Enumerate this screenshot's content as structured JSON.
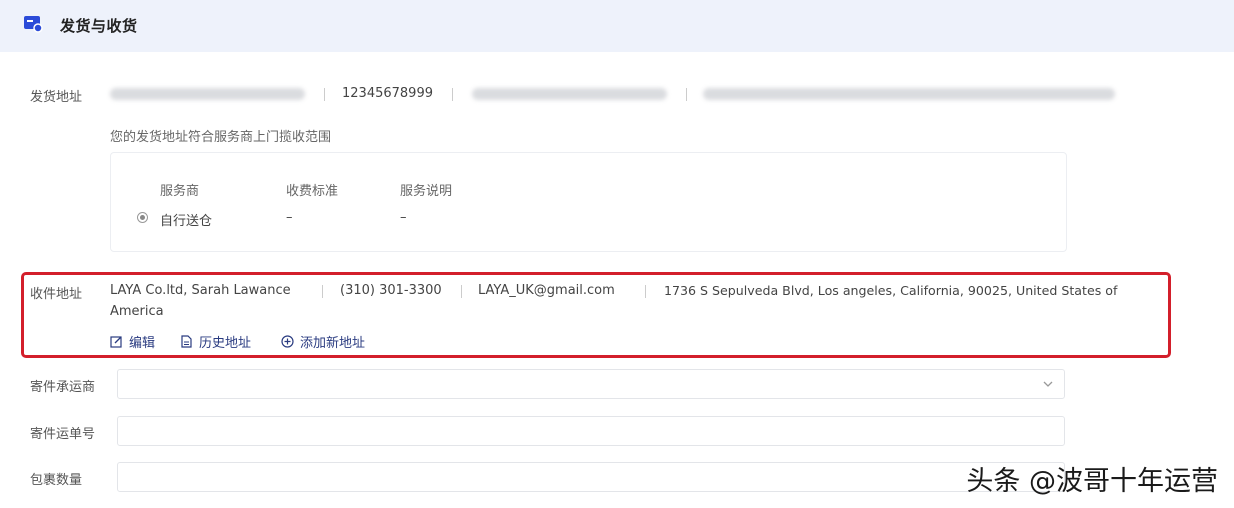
{
  "header": {
    "title": "发货与收货",
    "icon": "truck-card-icon"
  },
  "sender": {
    "label": "发货地址",
    "phone": "12345678999",
    "note": "您的发货地址符合服务商上门揽收范围"
  },
  "service_table": {
    "headers": [
      "服务商",
      "收费标准",
      "服务说明"
    ],
    "rows": [
      {
        "provider": "自行送仓",
        "fee": "–",
        "desc": "–"
      }
    ]
  },
  "receiver": {
    "label": "收件地址",
    "name": "LAYA Co.ltd, Sarah Lawance",
    "phone": "(310) 301-3300",
    "email": "LAYA_UK@gmail.com",
    "address_line1": "1736 S Sepulveda Blvd, Los angeles, California, 90025, United States of",
    "address_line2": "America",
    "actions": {
      "edit": "编辑",
      "history": "历史地址",
      "add": "添加新地址"
    },
    "highlight_color": "#d31f2b"
  },
  "form": {
    "carrier_label": "寄件承运商",
    "tracking_label": "寄件运单号",
    "packages_label": "包裹数量"
  },
  "watermark": "头条 @波哥十年运营",
  "colors": {
    "header_bg": "#eef2fb",
    "accent": "#2a3b80"
  }
}
